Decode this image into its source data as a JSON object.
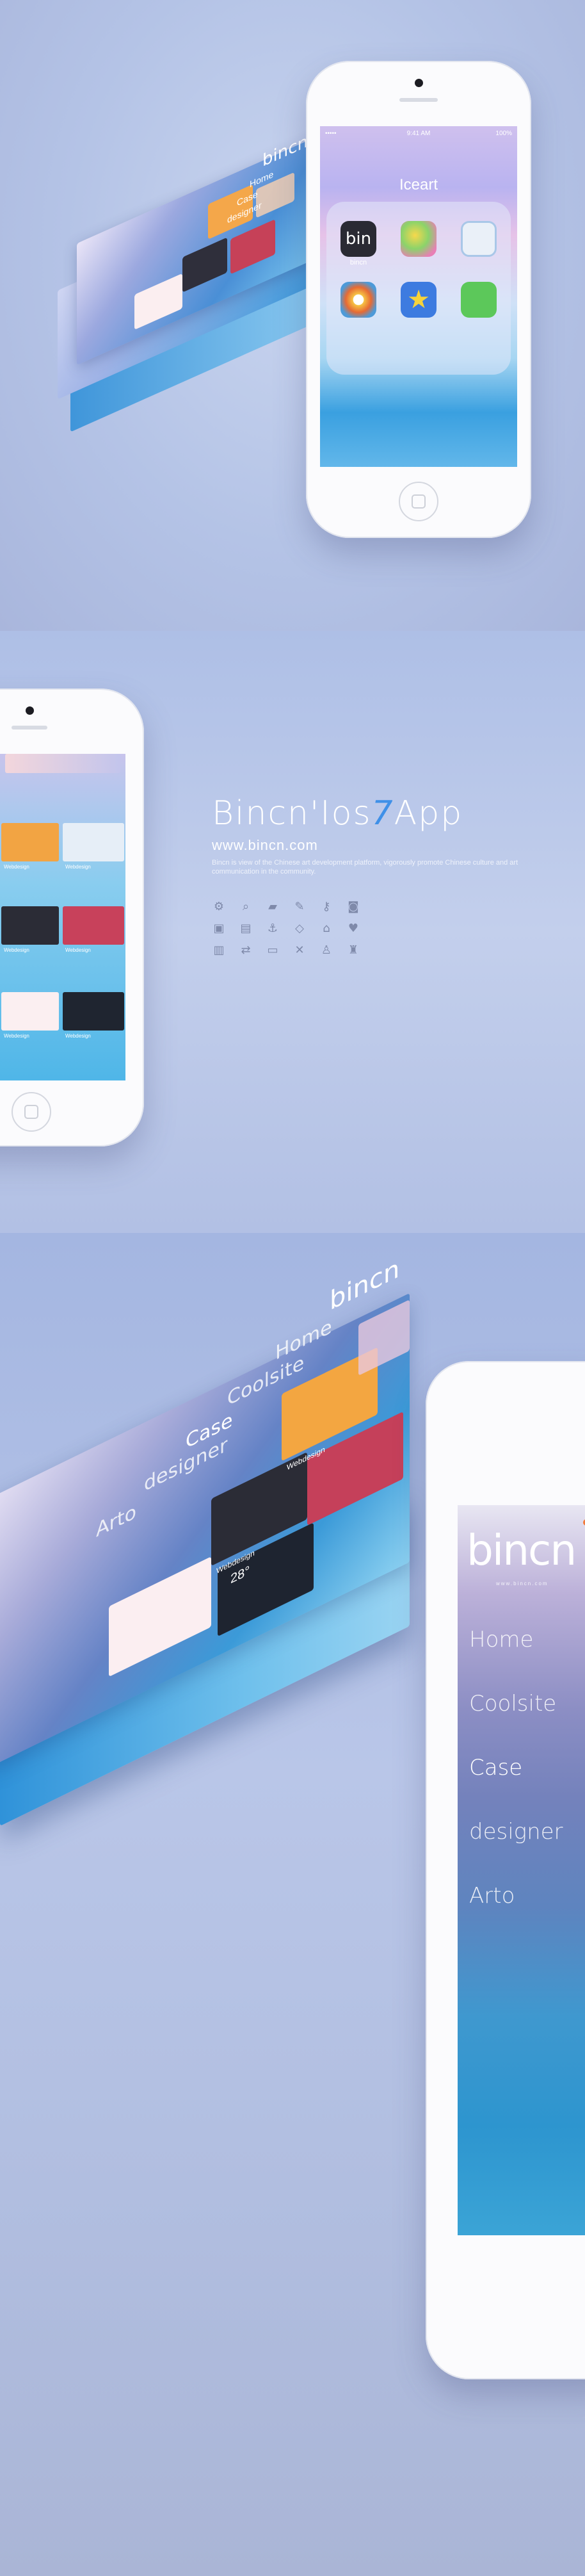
{
  "section1": {
    "status": {
      "carrier": "••••• ",
      "time": "9:41 AM",
      "battery": "100%"
    },
    "folder_name": "Iceart",
    "apps": [
      {
        "label": "bincn",
        "icon": "bincn-logo-icon",
        "text": "bin"
      },
      {
        "label": "",
        "icon": "bubble-app-icon"
      },
      {
        "label": "",
        "icon": "chat-app-icon"
      },
      {
        "label": "",
        "icon": "eye-app-icon"
      },
      {
        "label": "",
        "icon": "star-app-icon"
      },
      {
        "label": "",
        "icon": "wechat-app-icon"
      }
    ],
    "stack_menu": [
      "Home",
      "Case",
      "designer"
    ],
    "stack_logo": "bincn"
  },
  "section2": {
    "title_main": "Bincn'Ios",
    "title_slash": "7",
    "title_app": "App",
    "url": "www.bincn.com",
    "description": "Bincn is view of the Chinese art development platform, vigorously promote Chinese culture and art communication in the community.",
    "icons": [
      "gear-icon",
      "zoom-icon",
      "chat-icon",
      "pencil-icon",
      "key-icon",
      "camera-icon",
      "lock-icon",
      "document-icon",
      "anchor-icon",
      "tag-icon",
      "home-icon",
      "heart-icon",
      "book-icon",
      "swap-icon",
      "folder-icon",
      "wrench-icon",
      "person-icon",
      "bottle-icon"
    ],
    "tiles_caption": "Webdesign"
  },
  "section3": {
    "logo": "bincn",
    "logo_tagline": "www.bincn.com",
    "menu": [
      "Home",
      "Coolsite",
      "Case",
      "designer",
      "Arto"
    ],
    "stack_menu": [
      "Home",
      "Coolsite",
      "Case",
      "designer",
      "Arto"
    ],
    "stack_logo": "bincn",
    "tile_caption": "Webdesign",
    "temperature": "28°"
  }
}
